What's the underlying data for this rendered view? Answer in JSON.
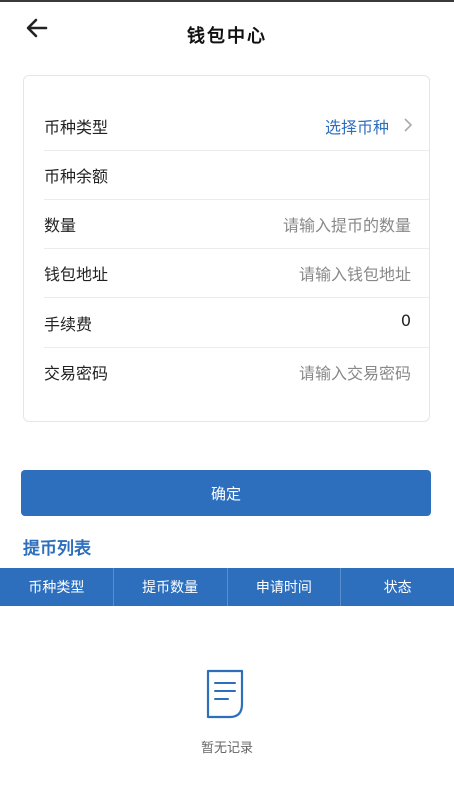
{
  "header": {
    "title": "钱包中心",
    "back_icon": "arrow-left-icon"
  },
  "form": {
    "rows": [
      {
        "label": "币种类型",
        "value": "选择币种",
        "icon": "chevron-right-icon"
      },
      {
        "label": "币种余额",
        "value": ""
      },
      {
        "label": "数量",
        "placeholder": "请输入提币的数量"
      },
      {
        "label": "钱包地址",
        "placeholder": "请输入钱包地址"
      },
      {
        "label": "手续费",
        "value": "0"
      },
      {
        "label": "交易密码",
        "placeholder": "请输入交易密码"
      }
    ]
  },
  "confirm_button": {
    "label": "确定"
  },
  "list": {
    "title": "提币列表",
    "columns": [
      "币种类型",
      "提币数量",
      "申请时间",
      "状态"
    ],
    "rows": [],
    "empty_text": "暂无记录",
    "empty_icon": "document-icon"
  },
  "colors": {
    "accent": "#2d6fbd",
    "link": "#2f6fbf"
  }
}
